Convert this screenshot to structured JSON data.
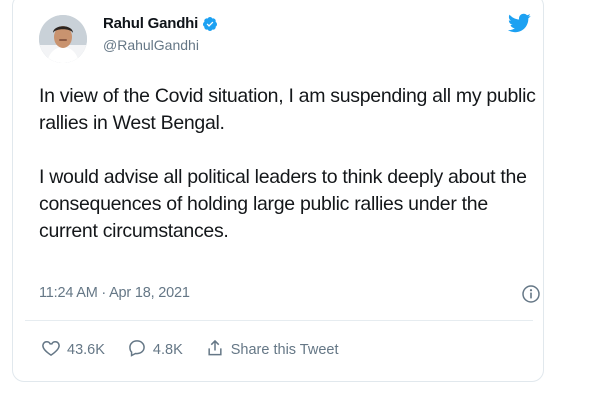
{
  "user": {
    "name": "Rahul Gandhi",
    "handle": "@RahulGandhi",
    "verified": true
  },
  "tweet": {
    "paragraphs": [
      "In view of the Covid situation, I am suspending all my public rallies in West Bengal.",
      "I would advise all political leaders to think deeply about the consequences of holding large public rallies under the current circumstances."
    ],
    "timestamp": "11:24 AM · Apr 18, 2021"
  },
  "actions": {
    "likes": "43.6K",
    "replies": "4.8K",
    "share_label": "Share this Tweet"
  },
  "icons": {
    "brand": "twitter-bird-icon",
    "verified": "verified-badge-icon",
    "info": "info-icon",
    "like": "heart-icon",
    "reply": "reply-bubble-icon",
    "share": "share-icon"
  },
  "colors": {
    "brand_blue": "#1da1f2",
    "text": "#14171a",
    "muted": "#657786",
    "border": "#e1e8ed"
  }
}
